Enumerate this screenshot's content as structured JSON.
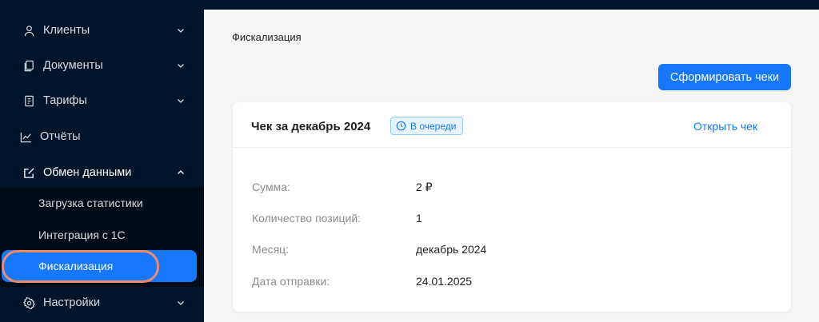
{
  "sidebar": {
    "items": [
      {
        "label": "Клиенты"
      },
      {
        "label": "Документы"
      },
      {
        "label": "Тарифы"
      },
      {
        "label": "Отчёты"
      },
      {
        "label": "Обмен данными"
      },
      {
        "label": "Настройки"
      }
    ],
    "submenu": [
      {
        "label": "Загрузка статистики"
      },
      {
        "label": "Интеграция с 1С"
      },
      {
        "label": "Фискализация"
      }
    ]
  },
  "main": {
    "page_title": "Фискализация",
    "action_button": "Сформировать чеки",
    "card": {
      "title": "Чек за декабрь 2024",
      "status_badge": "В очереди",
      "open_link": "Открыть чек",
      "rows": [
        {
          "label": "Сумма:",
          "value": "2 ₽"
        },
        {
          "label": "Количество позиций:",
          "value": "1"
        },
        {
          "label": "Месяц:",
          "value": "декабрь 2024"
        },
        {
          "label": "Дата отправки:",
          "value": "24.01.2025"
        }
      ]
    }
  },
  "colors": {
    "sidebar_bg": "#001529",
    "accent": "#1677ff",
    "highlight_ring": "#f08a68"
  }
}
